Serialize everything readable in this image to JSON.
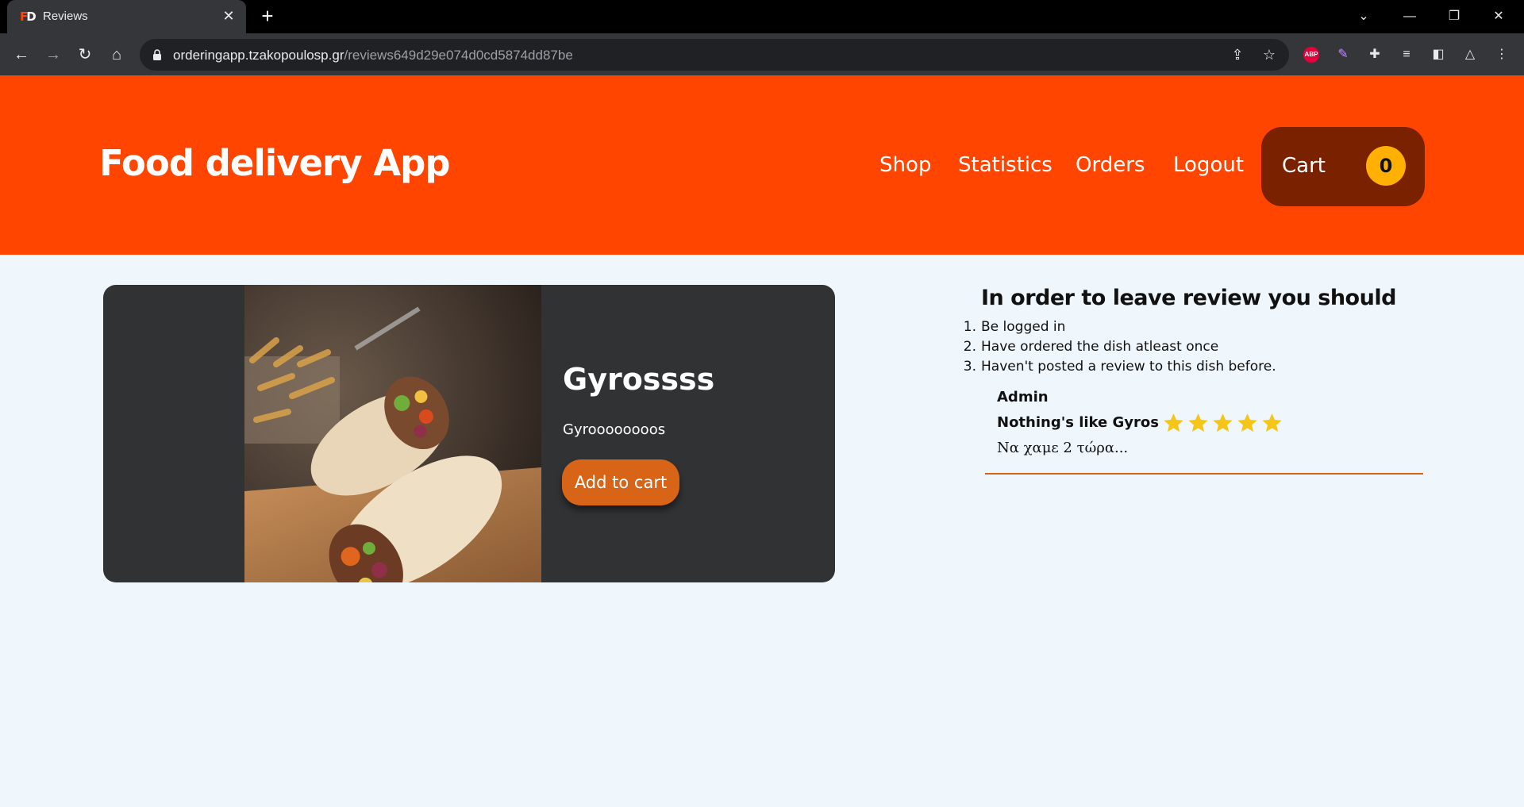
{
  "browser": {
    "tab": {
      "title": "Reviews",
      "favicon": "FD"
    },
    "url": {
      "host": "orderingapp.tzakopoulosp.gr",
      "path": "/reviews649d29e074d0cd5874dd87be"
    },
    "extensions": {
      "adblock_label": "ABP"
    }
  },
  "header": {
    "title": "Food delivery App",
    "nav": [
      "Shop",
      "Statistics",
      "Orders",
      "Logout"
    ],
    "cart": {
      "label": "Cart",
      "count": "0"
    },
    "colors": {
      "brand": "#ff4500",
      "cart_bg": "#7a2100",
      "badge": "#ffb000"
    }
  },
  "dish": {
    "name": "Gyrossss",
    "description": "Gyroooooooos",
    "add_to_cart_label": "Add to cart",
    "colors": {
      "card_bg": "#313233",
      "button": "#d86417"
    }
  },
  "review_rules": {
    "heading": "In order to leave review you should",
    "items": [
      "Be logged in",
      "Have ordered the dish atleast once",
      "Haven't posted a review to this dish before."
    ]
  },
  "reviews": [
    {
      "author": "Admin",
      "title": "Nothing's like Gyros",
      "rating": 5,
      "rating_max": 5,
      "body": "Να χαμε 2 τώρα..."
    }
  ]
}
